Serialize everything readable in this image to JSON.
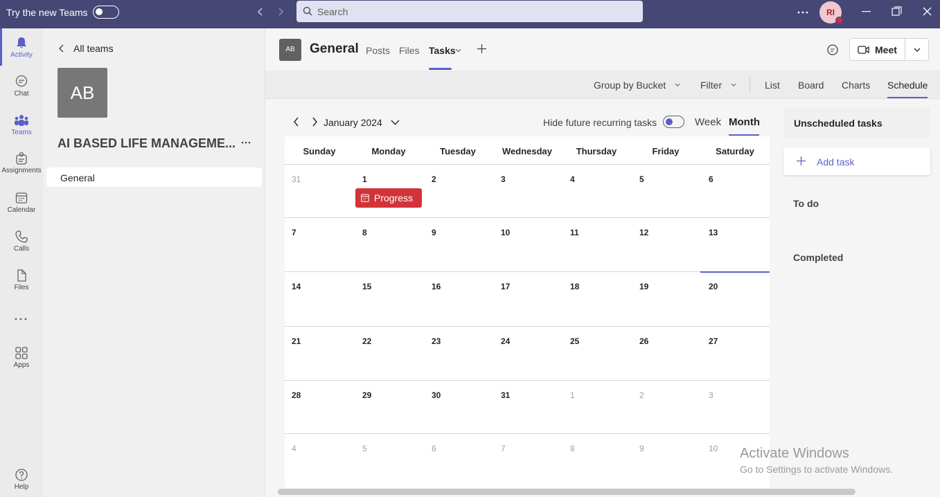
{
  "topbar": {
    "try_label": "Try the new Teams",
    "search_placeholder": "Search",
    "avatar_initials": "RI"
  },
  "rail": [
    {
      "label": "Activity",
      "icon": "bell-icon"
    },
    {
      "label": "Chat",
      "icon": "chat-icon"
    },
    {
      "label": "Teams",
      "icon": "teams-icon"
    },
    {
      "label": "Assignments",
      "icon": "assignments-icon"
    },
    {
      "label": "Calendar",
      "icon": "calendar-icon"
    },
    {
      "label": "Calls",
      "icon": "phone-icon"
    },
    {
      "label": "Files",
      "icon": "file-icon"
    },
    {
      "label": "Apps",
      "icon": "apps-icon"
    },
    {
      "label": "Help",
      "icon": "help-icon"
    }
  ],
  "teampanel": {
    "back_label": "All teams",
    "team_initials": "AB",
    "team_name": "AI BASED LIFE MANAGEME...",
    "channel": "General"
  },
  "header": {
    "channel_initials": "AB",
    "channel_title": "General",
    "tabs": [
      "Posts",
      "Files",
      "Tasks"
    ],
    "active_tab": "Tasks",
    "meet_label": "Meet"
  },
  "toolbar": {
    "group_by": "Group by Bucket",
    "filter": "Filter",
    "views": [
      "List",
      "Board",
      "Charts",
      "Schedule"
    ],
    "active_view": "Schedule"
  },
  "calendar": {
    "month_label": "January 2024",
    "hide_recurring_label": "Hide future recurring tasks",
    "week_label": "Week",
    "month_btn_label": "Month",
    "weekdays": [
      "Sunday",
      "Monday",
      "Tuesday",
      "Wednesday",
      "Thursday",
      "Friday",
      "Saturday"
    ],
    "weeks": [
      [
        "31",
        "1",
        "2",
        "3",
        "4",
        "5",
        "6"
      ],
      [
        "7",
        "8",
        "9",
        "10",
        "11",
        "12",
        "13"
      ],
      [
        "14",
        "15",
        "16",
        "17",
        "18",
        "19",
        "20"
      ],
      [
        "21",
        "22",
        "23",
        "24",
        "25",
        "26",
        "27"
      ],
      [
        "28",
        "29",
        "30",
        "31",
        "1",
        "2",
        "3"
      ],
      [
        "4",
        "5",
        "6",
        "7",
        "8",
        "9",
        "10"
      ]
    ],
    "task_label": "Progress ...",
    "task_color": "#d13438"
  },
  "rightpanel": {
    "unscheduled": "Unscheduled tasks",
    "add_task": "Add task",
    "todo": "To do",
    "completed": "Completed"
  },
  "watermark": {
    "line1": "Activate Windows",
    "line2": "Go to Settings to activate Windows."
  },
  "colors": {
    "accent": "#5b5fc7",
    "titlebar": "#464775"
  }
}
